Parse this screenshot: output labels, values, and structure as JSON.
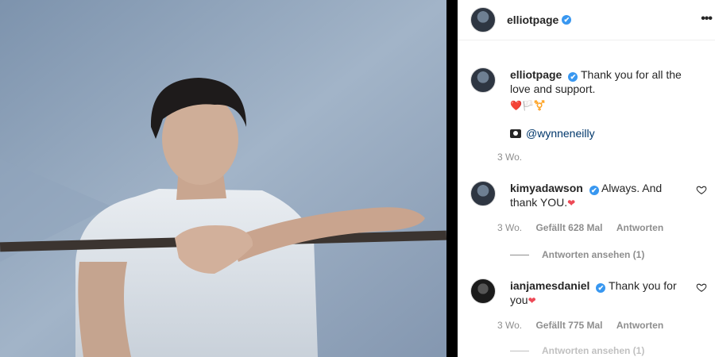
{
  "post": {
    "username": "elliotpage",
    "verified_mark": "✔",
    "more_label": "•••"
  },
  "caption": {
    "username": "elliotpage",
    "text": "Thank you for all the love and support.",
    "emojis": "❤️🏳️⚧️",
    "credit_mention": "@wynneneilly",
    "time": "3 Wo."
  },
  "comments": [
    {
      "username": "kimyadawson",
      "text": "Always. And thank YOU.",
      "emoji": "❤",
      "time": "3 Wo.",
      "likes": "Gefällt 628 Mal",
      "reply": "Antworten",
      "view_replies": "Antworten ansehen (1)"
    },
    {
      "username": "ianjamesdaniel",
      "text": "Thank you for you",
      "emoji": "❤",
      "time": "3 Wo.",
      "likes": "Gefällt 775 Mal",
      "reply": "Antworten",
      "view_replies": "Antworten ansehen (1)"
    }
  ],
  "colors": {
    "verified": "#3897f0",
    "meta_text": "#8e8e8e",
    "mention": "#00376b",
    "heart": "#ed4956"
  }
}
